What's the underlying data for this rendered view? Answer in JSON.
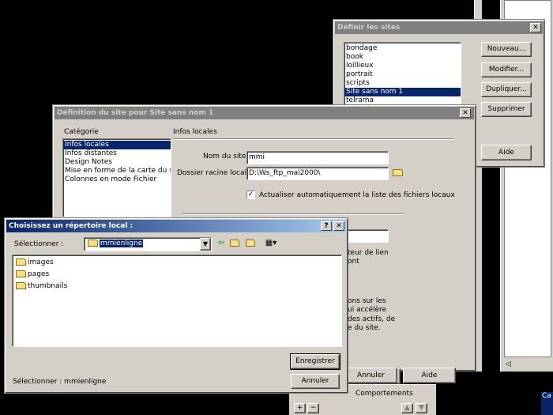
{
  "define_sites": {
    "title": "Définir les sites",
    "close_glyph": "✕",
    "sites": [
      "bondage",
      "book",
      "loillieux",
      "portrait",
      "scripts",
      "Site sans nom 1",
      "telrama"
    ],
    "selected_index": 5,
    "buttons": {
      "new": "Nouveau...",
      "edit": "Modifier...",
      "duplicate": "Dupliquer...",
      "delete": "Supprimer",
      "help": "Aide"
    }
  },
  "site_definition": {
    "title": "Définition du site pour  Site sans nom 1",
    "close_glyph": "✕",
    "category_label": "Catégorie",
    "categories": [
      "Infos locales",
      "Infos distantes",
      "Design Notes",
      "Mise en forme de la carte du site",
      "Colonnes en mode Fichier"
    ],
    "selected_category": 0,
    "section_title": "Infos locales",
    "site_name_label": "Nom du site :",
    "site_name_value": "mmi",
    "root_folder_label": "Dossier racine local :",
    "root_folder_value": "D:\\Ws_ftp_mai2000\\",
    "auto_refresh_checked": true,
    "auto_refresh_label": "Actualiser automatiquement la liste des fichiers locaux",
    "partial_text": [
      "teur de lien",
      "ont",
      "ons sur les",
      "ui accélère",
      "des actifs, de",
      "e du site."
    ],
    "cancel": "Annuler",
    "help": "Aide"
  },
  "choose_dir": {
    "title": "Choisissez un répertoire local :",
    "help_glyph": "?",
    "close_glyph": "✕",
    "look_in_label": "Sélectionner :",
    "look_in_value": "mmienligne",
    "folders": [
      "images",
      "pages",
      "thumbnails"
    ],
    "save": "Enregistrer",
    "cancel": "Annuler",
    "status_text": "Sélectionner : mmienligne"
  },
  "bottom_panel": {
    "text": "Comportements",
    "plus": "+",
    "minus": "−",
    "tab_label": "Ca",
    "tab_label2": "☰ C"
  },
  "colors": {
    "window_bg": "#d4d0c8",
    "active_title": "#0a246a",
    "inactive_title": "#808080",
    "selection": "#0a246a"
  }
}
